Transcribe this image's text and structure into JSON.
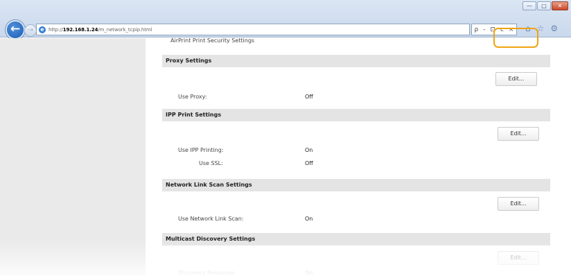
{
  "browser": {
    "url_prefix": "http://",
    "url_host": "192.168.1.24",
    "url_path": "/m_network_tcpip.html",
    "address_tools": [
      "ρ",
      "-",
      "⊡",
      "ᴄ",
      "×"
    ],
    "nav_icons": [
      "home-icon",
      "star-icon",
      "gear-icon"
    ],
    "window_controls": [
      "—",
      "□",
      "✕"
    ]
  },
  "page": {
    "top_item": "AirPrint Print Security Settings",
    "sections": {
      "proxy": {
        "title": "Proxy Settings",
        "edit_label": "Edit...",
        "rows": [
          {
            "label": "Use Proxy:",
            "value": "Off"
          }
        ]
      },
      "ipp": {
        "title": "IPP Print Settings",
        "edit_label": "Edit...",
        "rows": [
          {
            "label": "Use IPP Printing:",
            "value": "On"
          },
          {
            "label": "Use SSL:",
            "value": "Off"
          }
        ]
      },
      "network_link": {
        "title": "Network Link Scan Settings",
        "edit_label": "Edit...",
        "rows": [
          {
            "label": "Use Network Link Scan:",
            "value": "On"
          }
        ]
      },
      "multicast": {
        "title": "Multicast Discovery Settings",
        "edit_label": "Edit...",
        "rows": [
          {
            "label": "Discovery Response:",
            "value": "On"
          }
        ]
      }
    }
  },
  "colors": {
    "highlight": "#f0a30e",
    "section_header": "#e4e4e4",
    "sidebar": "#eaeaea"
  }
}
